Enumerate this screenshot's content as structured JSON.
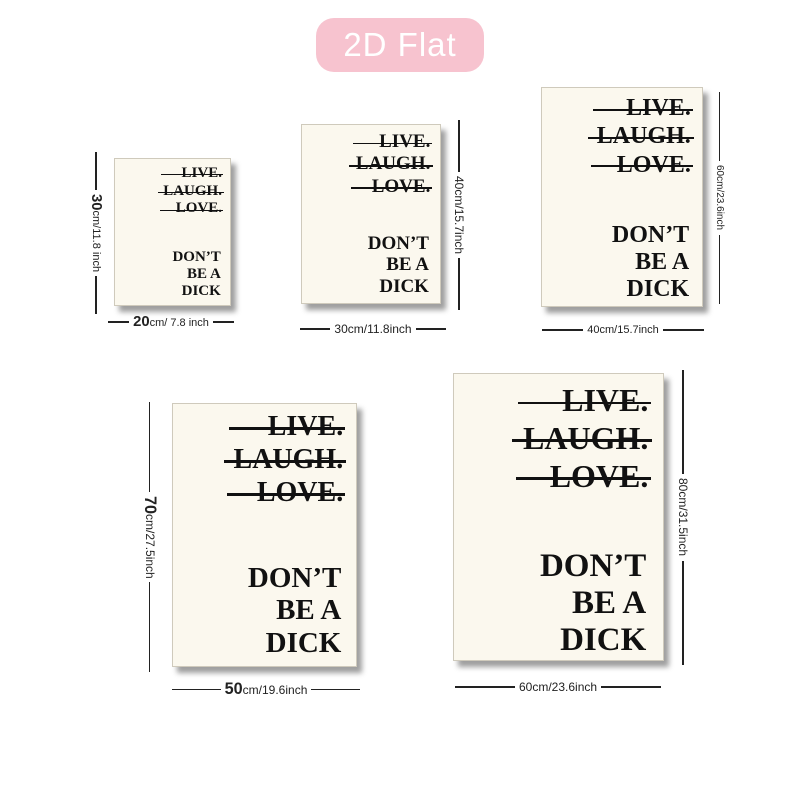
{
  "badge": "2D Flat",
  "poster": {
    "strike_lines": [
      "LIVE.",
      "LAUGH.",
      "LOVE."
    ],
    "tagline": [
      "DON’T",
      "BE A",
      "DICK"
    ],
    "colors": {
      "paper": "#fbf8ee",
      "ink": "#111111",
      "badge": "#f7c3cf"
    }
  },
  "sizes": [
    {
      "width_cm": "20",
      "width_unit": "cm/",
      "width_in": " 7.8 inch",
      "height_cm": "30",
      "height_unit": "cm/",
      "height_in": "11.8 inch"
    },
    {
      "width_cm": "30",
      "width_unit": "cm/",
      "width_in": "11.8inch",
      "height_cm": "40",
      "height_unit": "cm/",
      "height_in": "15.7inch"
    },
    {
      "width_cm": "40",
      "width_unit": "cm/",
      "width_in": "15.7inch",
      "height_cm": "60",
      "height_unit": "cm/",
      "height_in": "23.6inch"
    },
    {
      "width_cm": "50",
      "width_unit": "cm/",
      "width_in": "19.6inch",
      "height_cm": "70",
      "height_unit": "cm/",
      "height_in": "27.5inch"
    },
    {
      "width_cm": "60",
      "width_unit": "cm/",
      "width_in": "23.6inch",
      "height_cm": "80",
      "height_unit": "cm/",
      "height_in": "31.5inch"
    }
  ]
}
